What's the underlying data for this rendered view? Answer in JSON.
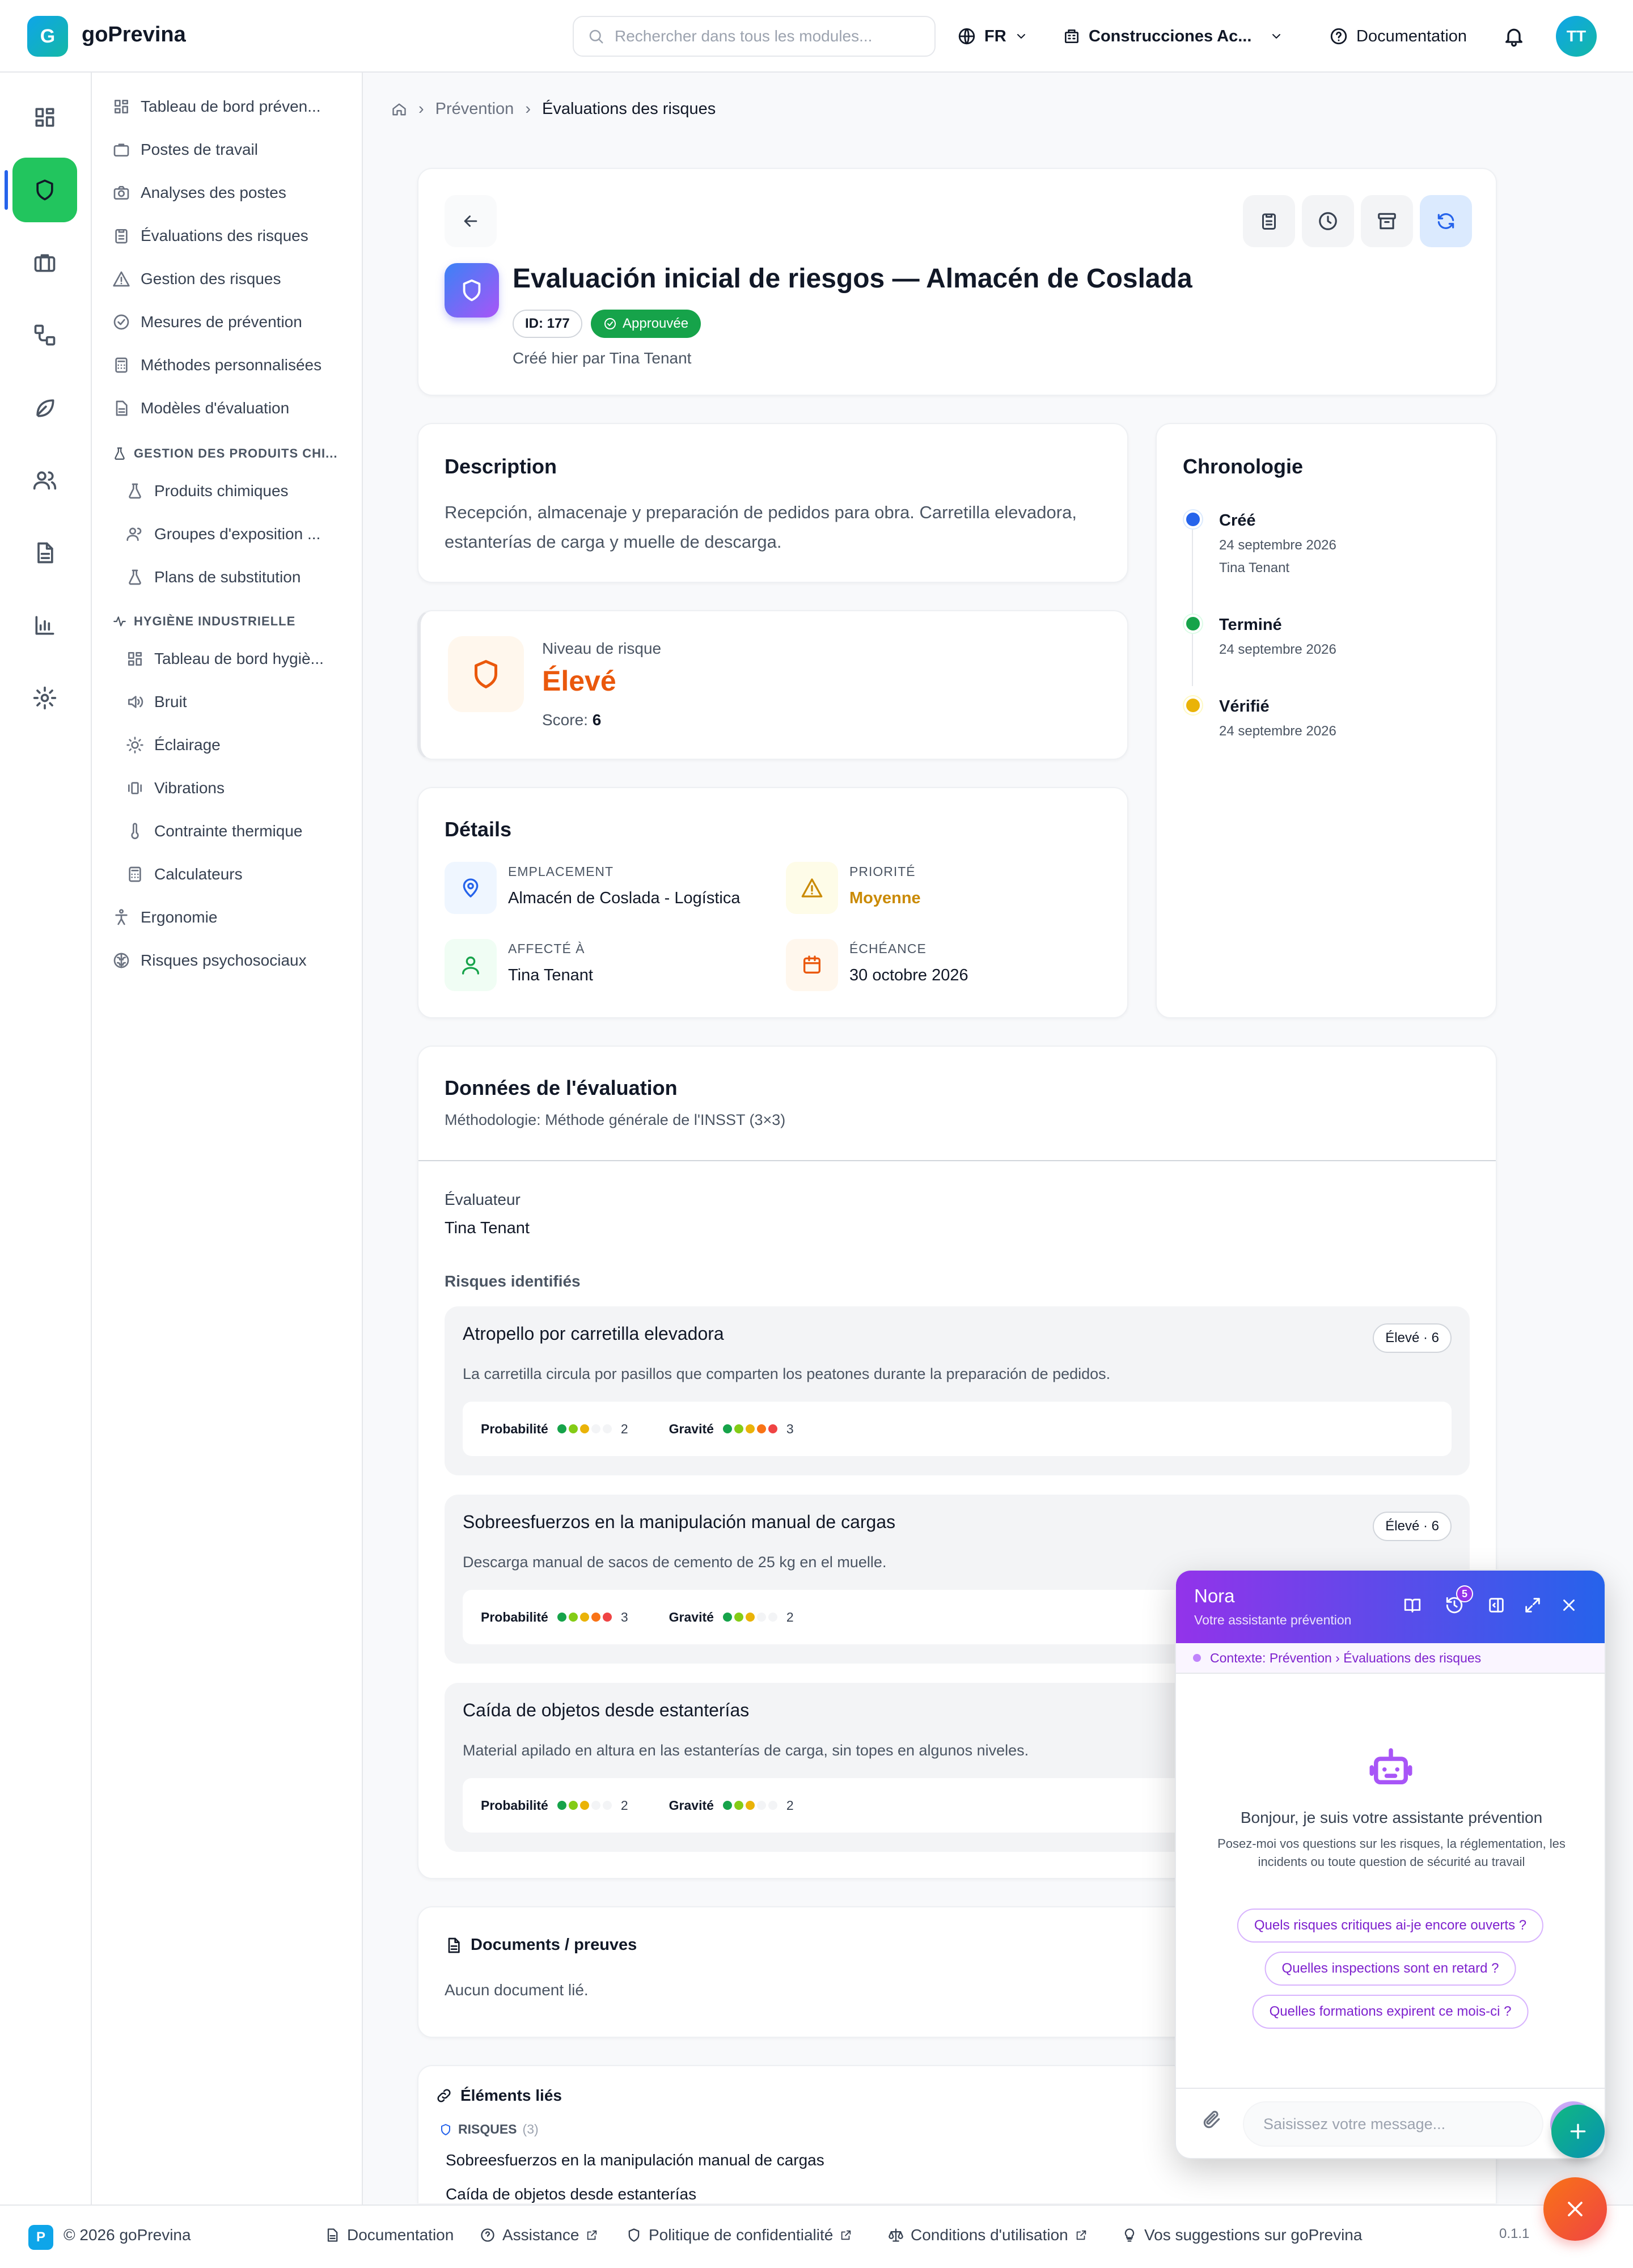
{
  "app": {
    "logo_letter": "G",
    "name": "goPrevina"
  },
  "header": {
    "search_placeholder": "Rechercher dans tous les modules...",
    "language": "FR",
    "company": "Construcciones Ac...",
    "documentation": "Documentation",
    "avatar_initials": "TT"
  },
  "rail": {
    "icons": [
      "dashboard-icon",
      "shield-icon",
      "briefcase-icon",
      "workflow-icon",
      "leaf-icon",
      "users-icon",
      "document-icon",
      "bar-chart-icon",
      "settings-icon"
    ]
  },
  "nav": {
    "items": [
      "Tableau de bord préven...",
      "Postes de travail",
      "Analyses des postes",
      "Évaluations des risques",
      "Gestion des risques",
      "Mesures de prévention",
      "Méthodes personnalisées",
      "Modèles d'évaluation"
    ],
    "chem_header": "GESTION DES PRODUITS CHI...",
    "chem_items": [
      "Produits chimiques",
      "Groupes d'exposition ...",
      "Plans de substitution"
    ],
    "hyg_header": "HYGIÈNE INDUSTRIELLE",
    "hyg_items": [
      "Tableau de bord hygiè...",
      "Bruit",
      "Éclairage",
      "Vibrations",
      "Contrainte thermique",
      "Calculateurs"
    ],
    "bottom_items": [
      "Ergonomie",
      "Risques psychosociaux"
    ]
  },
  "breadcrumb": {
    "section": "Prévention",
    "current": "Évaluations des risques"
  },
  "evaluation": {
    "title": "Evaluación inicial de riesgos — Almacén de Coslada",
    "id_badge": "ID: 177",
    "status": "Approuvée",
    "created": "Créé hier par Tina Tenant"
  },
  "description": {
    "heading": "Description",
    "text": "Recepción, almacenaje y preparación de pedidos para obra. Carretilla elevadora, estanterías de carga y muelle de descarga."
  },
  "risk_level": {
    "label": "Niveau de risque",
    "value": "Élevé",
    "score_label": "Score:",
    "score": "6"
  },
  "details": {
    "heading": "Détails",
    "location_label": "EMPLACEMENT",
    "location": "Almacén de Coslada - Logística",
    "priority_label": "PRIORITÉ",
    "priority": "Moyenne",
    "assigned_label": "AFFECTÉ À",
    "assigned": "Tina Tenant",
    "due_label": "ÉCHÉANCE",
    "due": "30 octobre 2026"
  },
  "timeline": {
    "heading": "Chronologie",
    "events": [
      {
        "title": "Créé",
        "date": "24 septembre 2026",
        "by": "Tina Tenant",
        "color": "#2563eb"
      },
      {
        "title": "Terminé",
        "date": "24 septembre 2026",
        "color": "#16a34a"
      },
      {
        "title": "Vérifié",
        "date": "24 septembre 2026",
        "color": "#eab308"
      }
    ]
  },
  "assessment": {
    "heading": "Données de l'évaluation",
    "methodology": "Méthodologie: Méthode générale de l'INSST (3×3)",
    "evaluator_label": "Évaluateur",
    "evaluator": "Tina Tenant",
    "risks_label": "Risques identifiés",
    "prob_label": "Probabilité",
    "sev_label": "Gravité",
    "risks": [
      {
        "title": "Atropello por carretilla elevadora",
        "badge": "Élevé · 6",
        "desc": "La carretilla circula por pasillos que comparten los peatones durante la preparación de pedidos.",
        "probability": "2",
        "severity": "3"
      },
      {
        "title": "Sobreesfuerzos en la manipulación manual de cargas",
        "badge": "Élevé · 6",
        "desc": "Descarga manual de sacos de cemento de 25 kg en el muelle.",
        "probability": "3",
        "severity": "2"
      },
      {
        "title": "Caída de objetos desde estanterías",
        "badge": "",
        "desc": "Material apilado en altura en las estanterías de carga, sin topes en algunos niveles.",
        "probability": "2",
        "severity": "2"
      }
    ]
  },
  "documents": {
    "heading": "Documents / preuves",
    "empty": "Aucun document lié."
  },
  "linked": {
    "heading": "Éléments liés",
    "risks_label": "RISQUES",
    "risks_count": "(3)",
    "items": [
      "Sobreesfuerzos en la manipulación manual de cargas",
      "Caída de objetos desde estanterías"
    ]
  },
  "footer": {
    "badge": "P",
    "copyright": "© 2026 goPrevina",
    "documentation": "Documentation",
    "assistance": "Assistance",
    "privacy": "Politique de confidentialité",
    "terms": "Conditions d'utilisation",
    "suggestions": "Vos suggestions sur goPrevina",
    "version": "0.1.1"
  },
  "chat": {
    "name": "Nora",
    "subtitle": "Votre assistante prévention",
    "history_count": "5",
    "context": "Contexte: Prévention › Évaluations des risques",
    "greeting": "Bonjour, je suis votre assistante prévention",
    "intro": "Posez-moi vos questions sur les risques, la réglementation, les incidents ou toute question de sécurité au travail",
    "suggestions": [
      "Quels risques critiques ai-je encore ouverts ?",
      "Quelles inspections sont en retard ?",
      "Quelles formations expirent ce mois-ci ?"
    ],
    "input_placeholder": "Saisissez votre message..."
  },
  "colors": {
    "accent": "#22c55e",
    "risk_high": "#ea580c",
    "priority_medium": "#ca8a04",
    "status_approved": "#16a34a",
    "chat_gradient_start": "#9333ea",
    "chat_gradient_end": "#2563eb",
    "fab": "#f97316"
  }
}
